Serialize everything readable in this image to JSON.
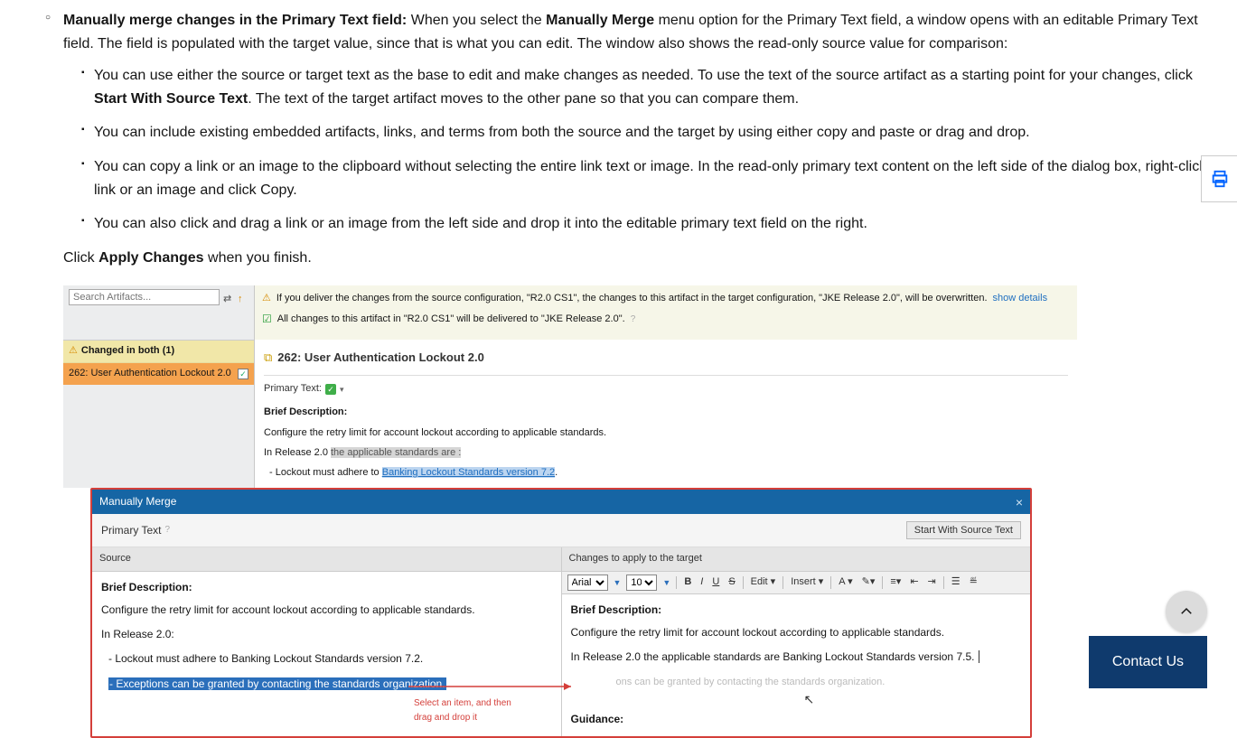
{
  "doc": {
    "main_item_bold": "Manually merge changes in the Primary Text field:",
    "main_item_rest_a": " When you select the ",
    "main_item_bold2": "Manually Merge",
    "main_item_rest_b": " menu option for the Primary Text field, a window opens with an editable Primary Text field. The field is populated with the target value, since that is what you can edit. The window also shows the read-only source value for comparison:",
    "sub1_a": "You can use either the source or target text as the base to edit and make changes as needed. To use the text of the source artifact as a starting point for your changes, click ",
    "sub1_bold": "Start With Source Text",
    "sub1_b": ". The text of the target artifact moves to the other pane so that you can compare them.",
    "sub2": "You can include existing embedded artifacts, links, and terms from both the source and the target by using either copy and paste or drag and drop.",
    "sub3": "You can copy a link or an image to the clipboard without selecting the entire link text or image. In the read-only primary text content on the left side of the dialog box, right-click a link or an image and click Copy.",
    "sub4": "You can also click and drag a link or an image from the left side and drop it into the editable primary text field on the right.",
    "after_a": "Click ",
    "after_bold": "Apply Changes",
    "after_b": " when you finish."
  },
  "shot": {
    "search_placeholder": "Search Artifacts...",
    "changed_label": "Changed in both (1)",
    "selected_item": "262:  User Authentication Lockout 2.0",
    "banner1_a": "If you deliver the changes from the source configuration, \"R2.0 CS1\", the changes to this artifact in the target configuration, \"JKE Release 2.0\", will be overwritten. ",
    "banner1_link": "show details",
    "banner2": "All changes to this artifact in \"R2.0 CS1\" will be delivered to \"JKE Release 2.0\".",
    "artifact_title": "262: User Authentication Lockout 2.0",
    "primary_text_label": "Primary Text:",
    "bd_title": "Brief Description:",
    "bd_text": "Configure the retry limit for account lockout according to applicable standards.",
    "rel_a": "In Release 2.0 ",
    "rel_grey": "the applicable standards are ",
    "lockout_a": "- Lockout must adhere to ",
    "lockout_link": "Banking Lockout Standards version 7.2"
  },
  "dialog": {
    "title": "Manually Merge",
    "subtitle": "Primary Text",
    "start_btn": "Start With Source Text",
    "src_hdr": "Source",
    "tgt_hdr": "Changes to apply to the target",
    "bd_title": "Brief Description:",
    "bd_text": "Configure the retry limit for account lockout according to applicable standards.",
    "src_rel": "In Release 2.0:",
    "src_lockout": "- Lockout must adhere to Banking Lockout Standards version 7.2.",
    "src_hl": "- Exceptions can be granted by contacting the standards organization.",
    "red_note1": "Select an item, and then",
    "red_note2": "drag and drop it",
    "tgt_rel": "In Release 2.0 the applicable standards are Banking Lockout Standards version 7.5.",
    "tgt_faded": "ons can be granted by contacting the standards organization.",
    "tgt_guidance": "Guidance:",
    "font_name": "Arial",
    "font_size": "10",
    "edit_label": "Edit",
    "insert_label": "Insert"
  },
  "floating": {
    "contact": "Contact Us"
  }
}
